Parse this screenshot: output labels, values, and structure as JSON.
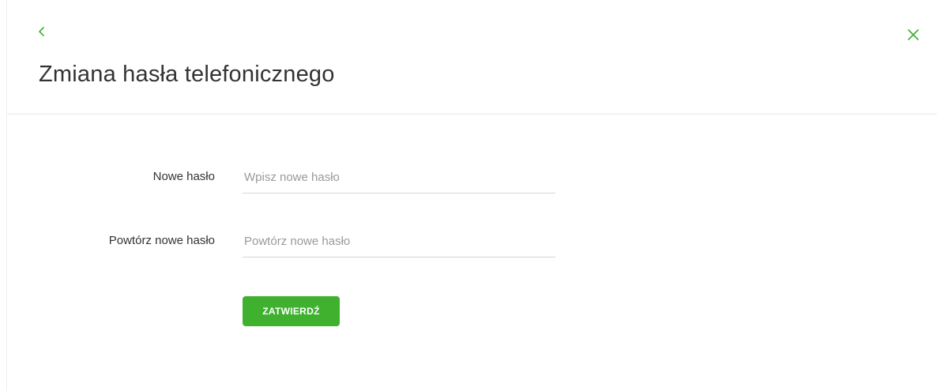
{
  "header": {
    "title": "Zmiana hasła telefonicznego",
    "back_icon": "chevron-left-icon",
    "close_icon": "close-icon"
  },
  "form": {
    "new_password": {
      "label": "Nowe hasło",
      "placeholder": "Wpisz nowe hasło",
      "value": ""
    },
    "repeat_password": {
      "label": "Powtórz nowe hasło",
      "placeholder": "Powtórz nowe hasło",
      "value": ""
    },
    "submit_label": "ZATWIERDŹ"
  },
  "colors": {
    "accent": "#3fb12f",
    "text": "#333333",
    "placeholder": "#999999",
    "divider": "#e8e8e8"
  }
}
